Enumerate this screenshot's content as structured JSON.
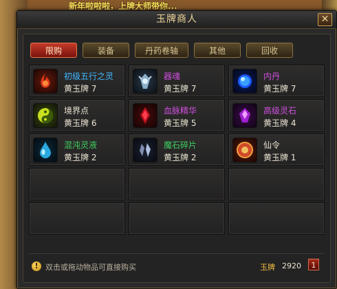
{
  "background": {
    "banner_text": "新年啦啦啦，上牌大师带你..."
  },
  "window": {
    "title": "玉牌商人",
    "close_label": "✕"
  },
  "tabs": [
    {
      "label": "限购",
      "active": true
    },
    {
      "label": "装备",
      "active": false
    },
    {
      "label": "丹药卷轴",
      "active": false
    },
    {
      "label": "其他",
      "active": false
    },
    {
      "label": "回收",
      "active": false
    }
  ],
  "items": [
    {
      "name": "初级五行之灵",
      "price": "黄玉牌 7",
      "name_color": "#3fb8ff",
      "icon": "flame-spirit-icon"
    },
    {
      "name": "器魂",
      "price": "黄玉牌 7",
      "name_color": "#d050e0",
      "icon": "artifact-soul-icon"
    },
    {
      "name": "内丹",
      "price": "黄玉牌 7",
      "name_color": "#d050e0",
      "icon": "inner-pill-icon"
    },
    {
      "name": "境界点",
      "price": "黄玉牌 6",
      "name_color": "#e8e2d0",
      "icon": "realm-point-icon"
    },
    {
      "name": "血脉精华",
      "price": "黄玉牌 5",
      "name_color": "#d050e0",
      "icon": "blood-essence-icon"
    },
    {
      "name": "高级灵石",
      "price": "黄玉牌 4",
      "name_color": "#d050e0",
      "icon": "spirit-stone-icon"
    },
    {
      "name": "混沌灵液",
      "price": "黄玉牌 2",
      "name_color": "#3fd060",
      "icon": "chaos-liquid-icon"
    },
    {
      "name": "魔石碎片",
      "price": "黄玉牌 2",
      "name_color": "#3fd060",
      "icon": "magic-stone-shard-icon"
    },
    {
      "name": "仙令",
      "price": "黄玉牌 1",
      "name_color": "#e8e2d0",
      "icon": "immortal-token-icon"
    }
  ],
  "footer": {
    "hint_icon": "!",
    "hint": "双击或拖动物品可直接购买",
    "currency_label": "玉牌",
    "currency_value": "2920",
    "page": "1"
  }
}
